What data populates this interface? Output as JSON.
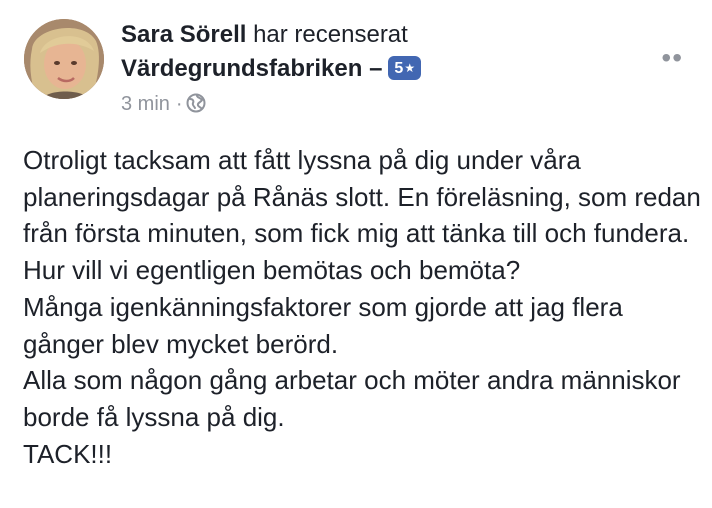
{
  "post": {
    "author": "Sara Sörell",
    "verb": "har recenserat",
    "page_name": "Värdegrundsfabriken –",
    "rating": "5",
    "rating_icon": "star-icon",
    "timestamp": "3 min",
    "separator": "·",
    "privacy_icon": "globe-icon",
    "more_icon": "more-options-icon",
    "more_glyph": "••",
    "body_lines": [
      "Otroligt tacksam att fått lyssna på dig under våra planeringsdagar på Rånäs slott. En föreläsning, som redan från första minuten, som fick mig att tänka till och fundera.",
      "Hur vill vi egentligen bemötas och bemöta?",
      "Många igenkänningsfaktorer som gjorde att jag flera gånger blev mycket berörd.",
      "Alla som någon gång arbetar och möter andra människor borde få lyssna på dig.",
      "TACK!!!"
    ]
  },
  "colors": {
    "text": "#1d2129",
    "meta": "#90949c",
    "badge": "#4267b2"
  }
}
